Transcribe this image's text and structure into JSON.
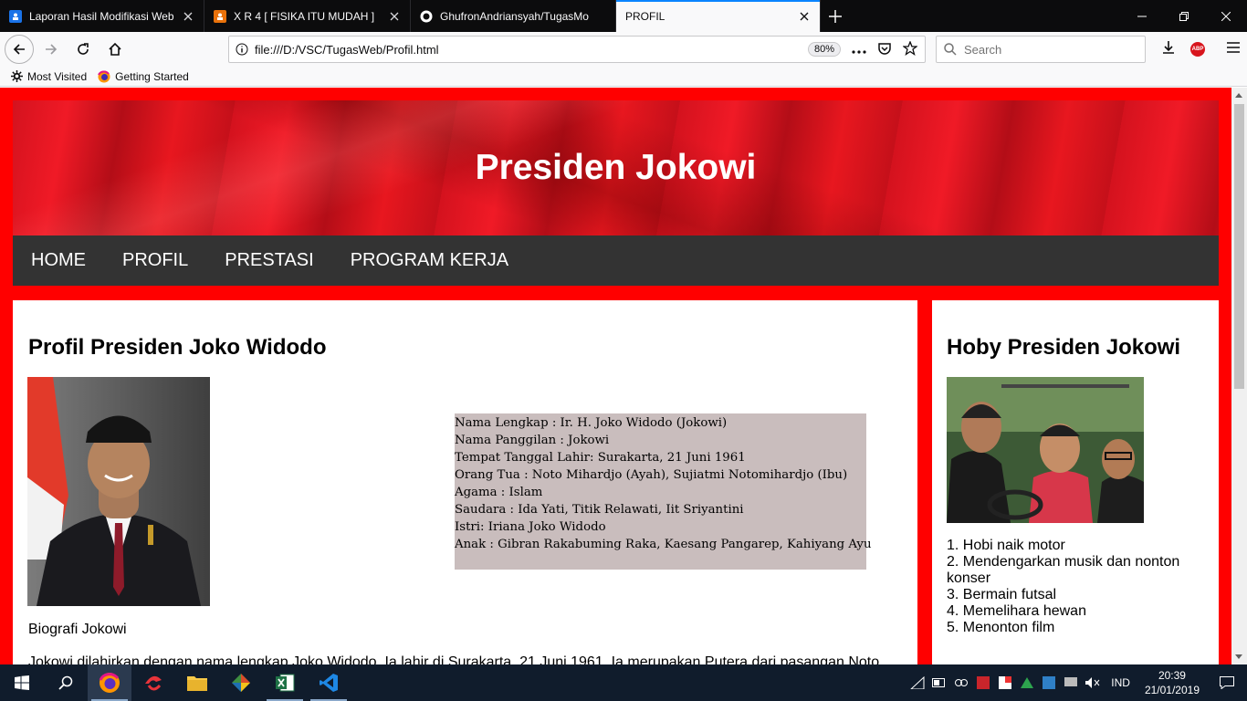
{
  "browser": {
    "tabs": [
      {
        "title": "Laporan Hasil Modifikasi Web",
        "icon": "classroom-icon",
        "active": false
      },
      {
        "title": "X R 4 [ FISIKA ITU MUDAH ]",
        "icon": "classroom-icon",
        "active": false
      },
      {
        "title": "GhufronAndriansyah/TugasMo",
        "icon": "github-icon",
        "active": false
      },
      {
        "title": "PROFIL",
        "icon": "",
        "active": true
      }
    ],
    "url": "file:///D:/VSC/TugasWeb/Profil.html",
    "zoom": "80%",
    "search_placeholder": "Search",
    "bookmarks": [
      {
        "label": "Most Visited",
        "icon": "gear-icon"
      },
      {
        "label": "Getting Started",
        "icon": "firefox-icon"
      }
    ]
  },
  "page": {
    "banner_title": "Presiden Jokowi",
    "menu": [
      "HOME",
      "PROFIL",
      "PRESTASI",
      "PROGRAM KERJA"
    ],
    "main": {
      "heading": "Profil Presiden Joko Widodo",
      "bio_lines": [
        "Nama Lengkap : Ir. H. Joko Widodo (Jokowi)",
        "Nama Panggilan : Jokowi",
        "Tempat Tanggal Lahir: Surakarta, 21 Juni 1961",
        "Orang Tua : Noto Mihardjo (Ayah), Sujiatmi Notomihardjo (Ibu)",
        "Agama : Islam",
        "Saudara : Ida Yati, Titik Relawati, Iit Sriyantini",
        "Istri: Iriana Joko Widodo",
        "Anak : Gibran Rakabuming Raka, Kaesang Pangarep, Kahiyang Ayu"
      ],
      "caption": "Biografi Jokowi",
      "paragraph_start": "Jokowi dilahirkan dengan nama lengkap Joko Widodo. Ia lahir di Surakarta, 21 Juni 1961. Ia merupakan Putera dari pasangan Noto"
    },
    "side": {
      "heading": "Hoby Presiden Jokowi",
      "hobbies": [
        "1. Hobi naik motor",
        "2. Mendengarkan musik dan nonton konser",
        "3. Bermain futsal",
        "4. Memelihara hewan",
        "5. Menonton film"
      ]
    }
  },
  "taskbar": {
    "apps": [
      "start-icon",
      "search-icon",
      "firefox-icon",
      "garena-icon",
      "file-explorer-icon",
      "git-icon",
      "excel-icon",
      "vscode-icon"
    ],
    "language": "IND",
    "time": "20:39",
    "date": "21/01/2019"
  },
  "colors": {
    "page_background": "#ff0000",
    "menu_background": "#333333",
    "bio_box": "#c9bdbd",
    "tab_accent": "#0a84ff"
  }
}
